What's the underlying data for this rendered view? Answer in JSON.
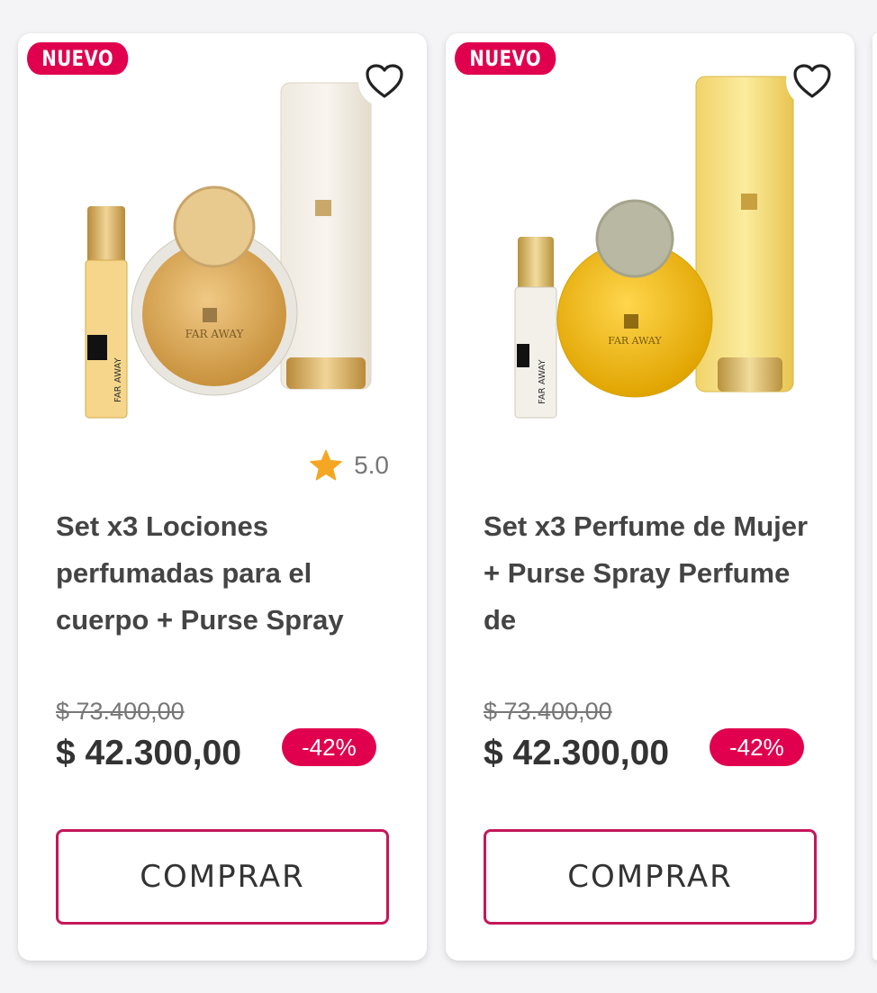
{
  "colors": {
    "accent": "#e0004d",
    "button_border": "#c5175a",
    "star": "#f5a623"
  },
  "products": [
    {
      "badge": "NUEVO",
      "favorite_icon": "heart-outline-icon",
      "image_alt": "FAR AWAY",
      "rating": "5.0",
      "title": "Set x3 Lociones perfumadas para el cuerpo + Purse Spray",
      "old_price": "$ 73.400,00",
      "price": "$ 42.300,00",
      "discount": "-42%",
      "button": "COMPRAR"
    },
    {
      "badge": "NUEVO",
      "favorite_icon": "heart-outline-icon",
      "image_alt": "FAR AWAY",
      "title": "Set x3 Perfume de Mujer + Purse Spray Perfume de",
      "old_price": "$ 73.400,00",
      "price": "$ 42.300,00",
      "discount": "-42%",
      "button": "COMPRAR"
    }
  ]
}
